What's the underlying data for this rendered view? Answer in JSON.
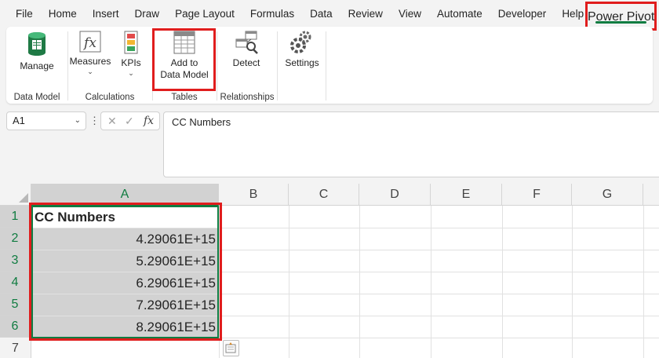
{
  "menu": [
    "File",
    "Home",
    "Insert",
    "Draw",
    "Page Layout",
    "Formulas",
    "Data",
    "Review",
    "View",
    "Automate",
    "Developer",
    "Help"
  ],
  "active_tab": "Power Pivot",
  "ribbon": {
    "manage": "Manage",
    "measures": "Measures",
    "kpis": "KPIs",
    "add_line1": "Add to",
    "add_line2": "Data Model",
    "detect": "Detect",
    "settings": "Settings",
    "groups": {
      "data_model": "Data Model",
      "calculations": "Calculations",
      "tables": "Tables",
      "relationships": "Relationships"
    }
  },
  "formula_bar": {
    "name_box": "A1",
    "fx": "fx",
    "content": "CC Numbers"
  },
  "grid": {
    "columns": [
      "A",
      "B",
      "C",
      "D",
      "E",
      "F",
      "G"
    ],
    "rows": [
      "1",
      "2",
      "3",
      "4",
      "5",
      "6",
      "7"
    ],
    "cells": {
      "a1": "CC Numbers",
      "a2": "4.29061E+15",
      "a3": "5.29061E+15",
      "a4": "6.29061E+15",
      "a5": "7.29061E+15",
      "a6": "8.29061E+15"
    }
  },
  "colors": {
    "accent_green": "#107c41",
    "highlight_red": "#e01d1d"
  }
}
